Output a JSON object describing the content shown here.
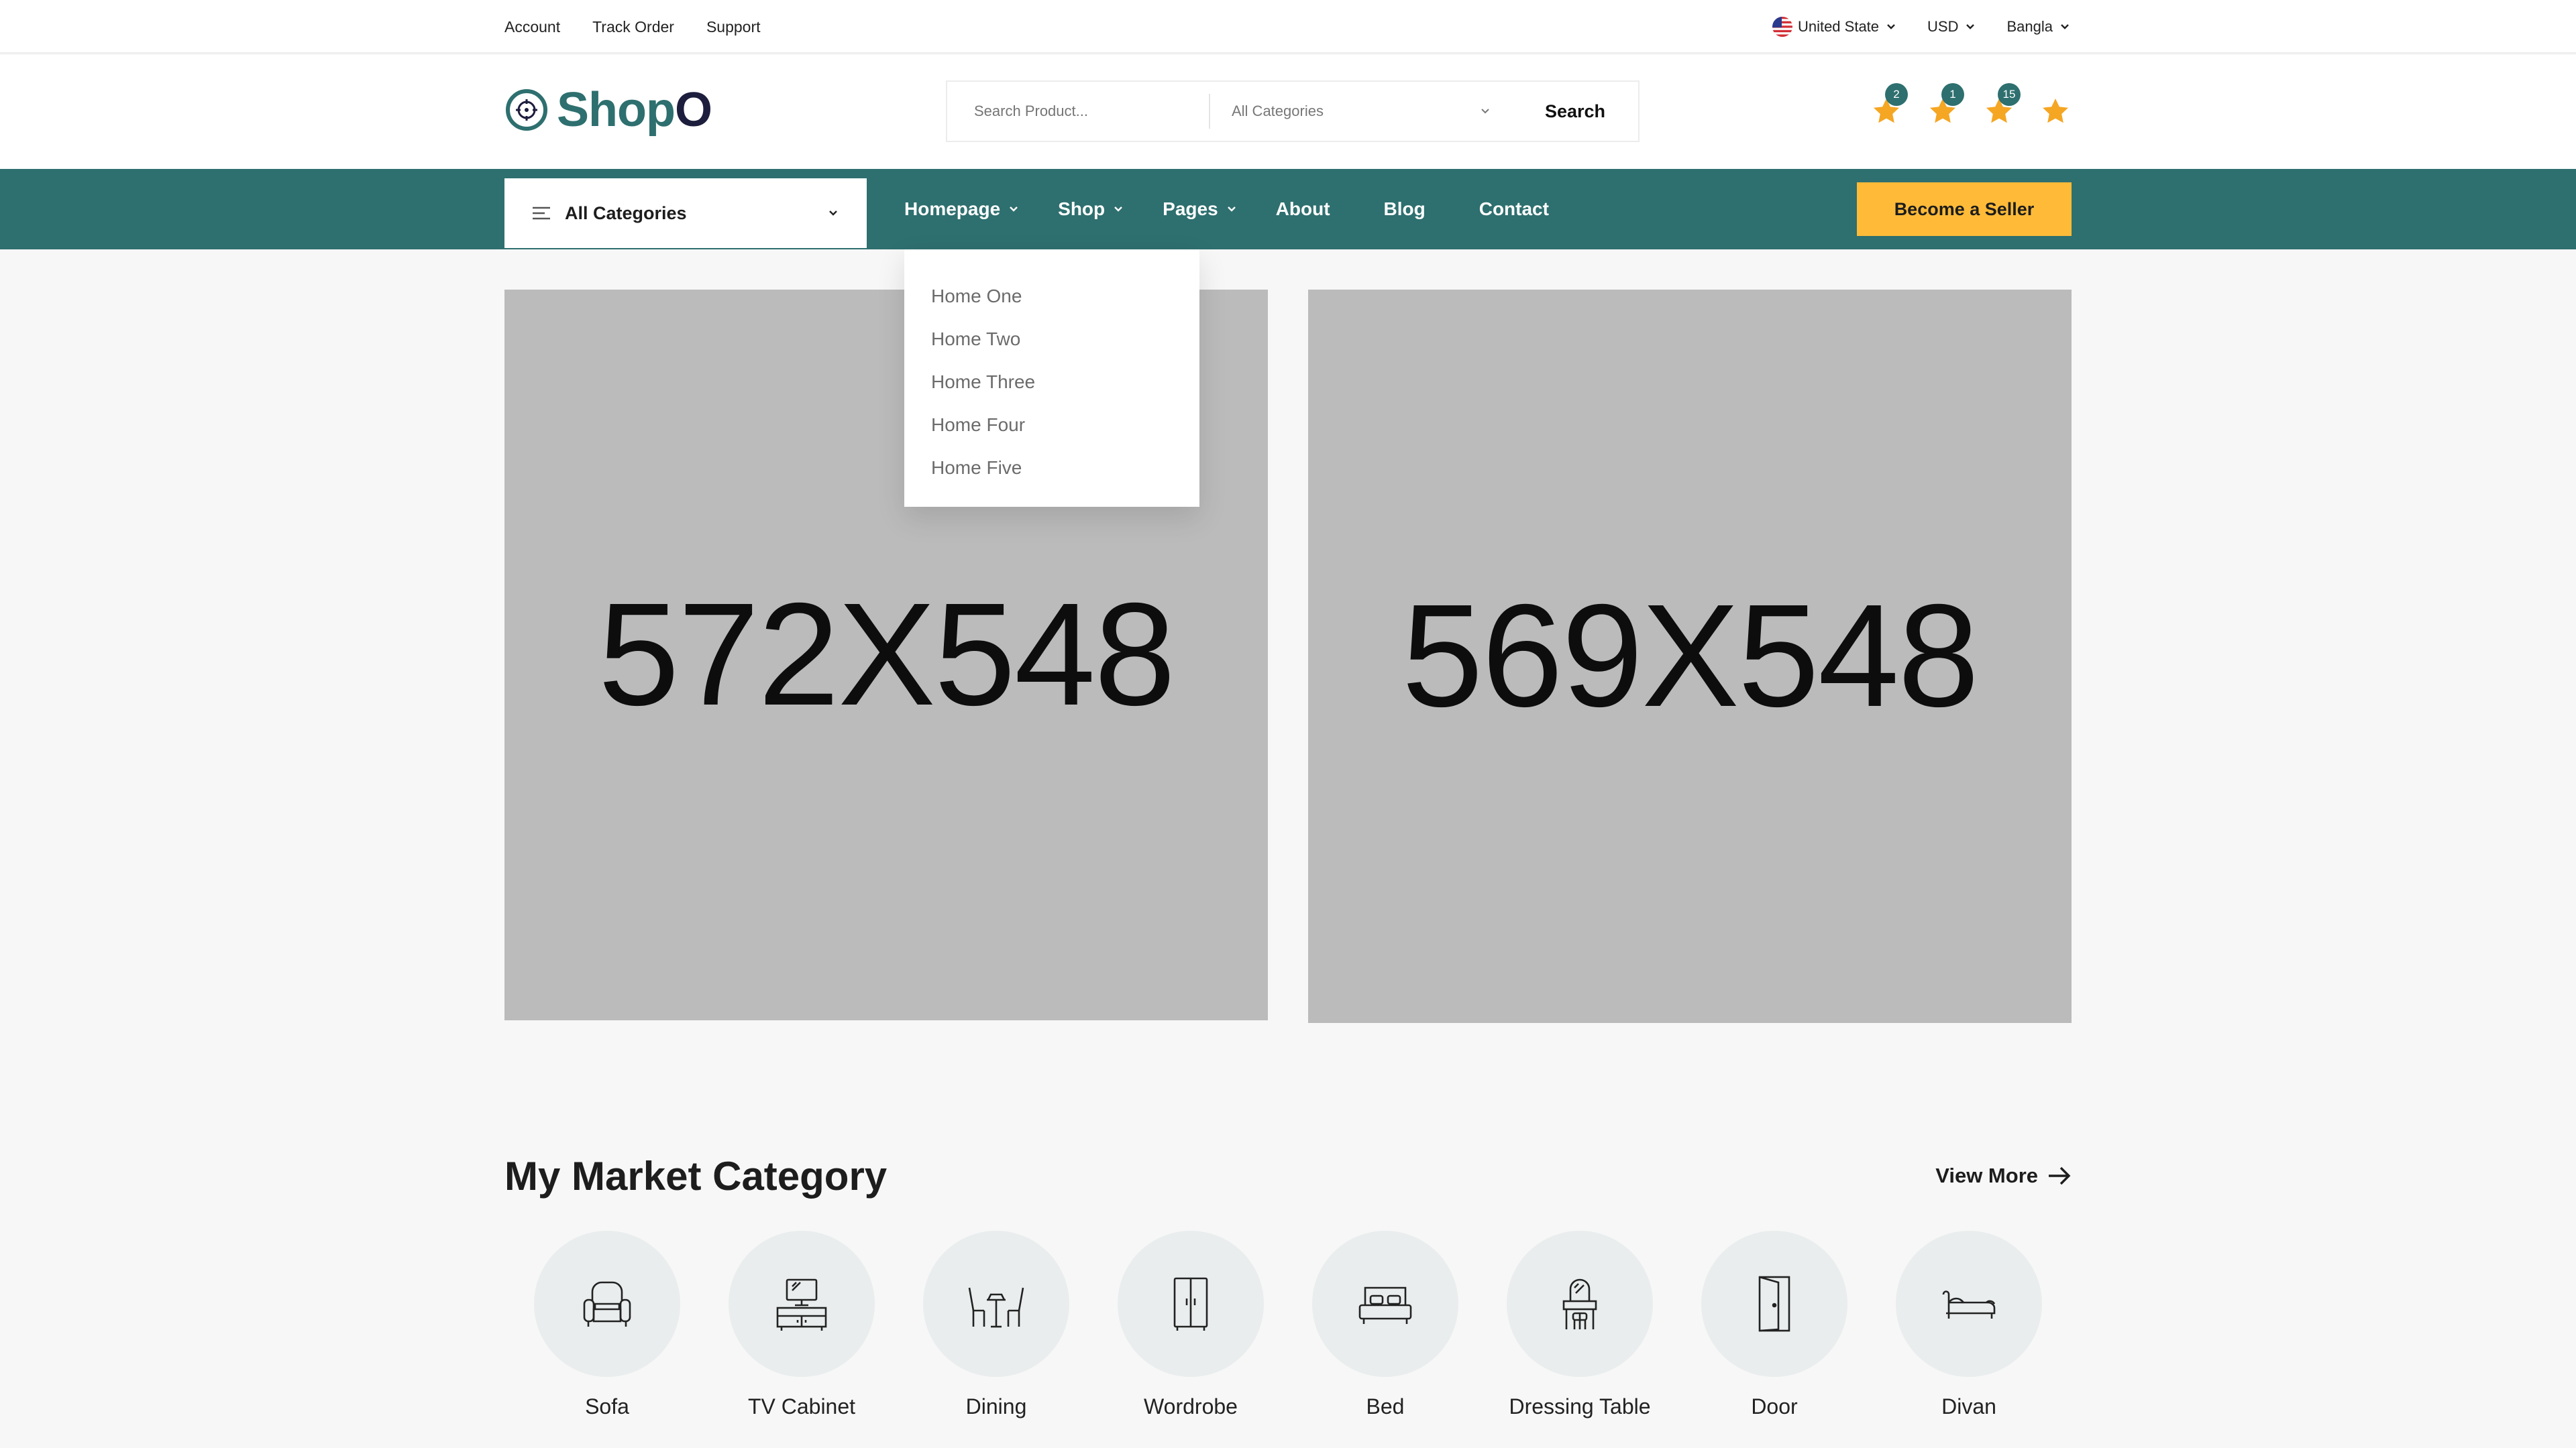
{
  "topbar": {
    "links": [
      "Account",
      "Track Order",
      "Support"
    ],
    "country": "United State",
    "currency": "USD",
    "language": "Bangla"
  },
  "header": {
    "logo_main": "Shop",
    "logo_tail": "O",
    "search_placeholder": "Search Product...",
    "category_select": "All Categories",
    "search_button": "Search",
    "icons": [
      {
        "icon": "star-icon",
        "badge": "2"
      },
      {
        "icon": "star-icon",
        "badge": "1"
      },
      {
        "icon": "star-icon",
        "badge": "15"
      },
      {
        "icon": "star-icon",
        "badge": ""
      }
    ]
  },
  "nav": {
    "all_categories": "All Categories",
    "links": [
      "Homepage",
      "Shop",
      "Pages",
      "About",
      "Blog",
      "Contact"
    ],
    "seller_button": "Become a Seller"
  },
  "dropdown": {
    "items": [
      "Home One",
      "Home Two",
      "Home Three",
      "Home Four",
      "Home Five"
    ]
  },
  "banners": [
    "572X548",
    "569X548"
  ],
  "market": {
    "title": "My Market Category",
    "view_more": "View More",
    "categories": [
      {
        "label": "Sofa",
        "icon": "sofa-icon"
      },
      {
        "label": "TV Cabinet",
        "icon": "tv-cabinet-icon"
      },
      {
        "label": "Dining",
        "icon": "dining-icon"
      },
      {
        "label": "Wordrobe",
        "icon": "wardrobe-icon"
      },
      {
        "label": "Bed",
        "icon": "bed-icon"
      },
      {
        "label": "Dressing Table",
        "icon": "dressing-table-icon"
      },
      {
        "label": "Door",
        "icon": "door-icon"
      },
      {
        "label": "Divan",
        "icon": "divan-icon"
      }
    ]
  },
  "colors": {
    "brand": "#2e6f6f",
    "accent": "#ffbb38",
    "badge": "#2e6f6f",
    "star": "#f5a623"
  }
}
